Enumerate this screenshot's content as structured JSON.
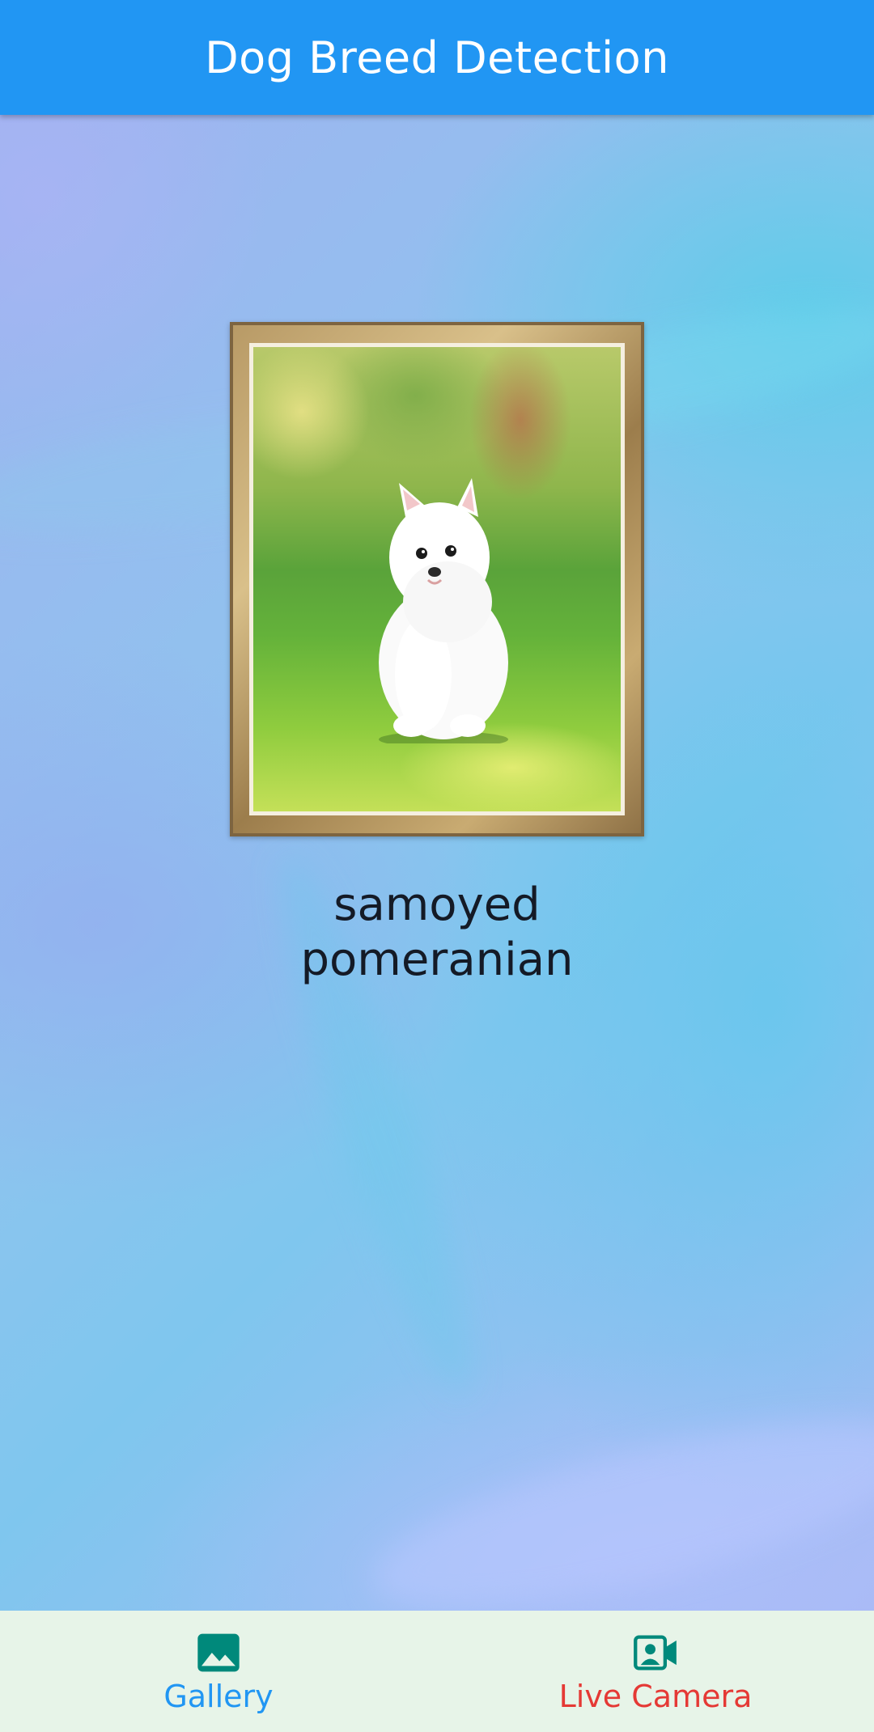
{
  "app_bar": {
    "title": "Dog Breed Detection"
  },
  "image": {
    "subject": "white fluffy puppy on grass in a gold picture frame"
  },
  "result": {
    "predictions": [
      "samoyed",
      "pomeranian"
    ]
  },
  "bottom_nav": {
    "items": [
      {
        "label": "Gallery",
        "icon": "image-icon",
        "label_color": "#2196F3"
      },
      {
        "label": "Live Camera",
        "icon": "video-camera-account-icon",
        "label_color": "#E53935"
      }
    ]
  },
  "colors": {
    "app_bar": "#2196F3",
    "nav_background": "#E7F4E8",
    "icon_color": "#00897B",
    "text_dark": "#141A26"
  }
}
